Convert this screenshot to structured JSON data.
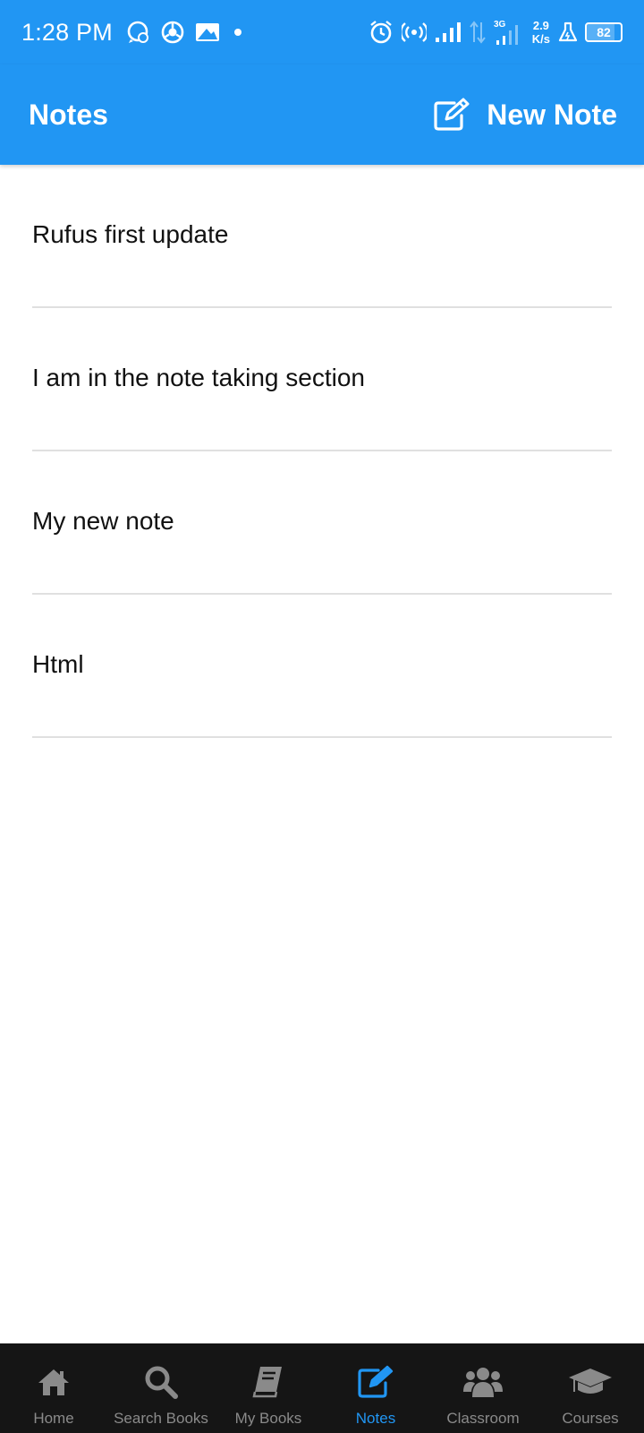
{
  "status_bar": {
    "time": "1:28 PM",
    "net_speed_value": "2.9",
    "net_speed_unit": "K/s",
    "network_type": "3G",
    "battery": "82",
    "battery_level": 0.82,
    "icons": [
      "whatsapp-icon",
      "chrome-icon",
      "gallery-icon",
      "dot-icon",
      "alarm-icon",
      "hotspot-icon",
      "signal-icon",
      "data-arrows-icon",
      "signal-3g-icon",
      "flask-icon",
      "battery-icon"
    ]
  },
  "app_bar": {
    "title": "Notes",
    "new_note_label": "New Note",
    "new_note_icon": "edit-icon"
  },
  "notes": [
    {
      "title": "Rufus first update"
    },
    {
      "title": "I am in the note taking section"
    },
    {
      "title": "My new note"
    },
    {
      "title": "Html"
    }
  ],
  "bottom_nav": {
    "active": "Notes",
    "items": [
      {
        "label": "Home",
        "icon": "home-icon"
      },
      {
        "label": "Search Books",
        "icon": "search-icon"
      },
      {
        "label": "My Books",
        "icon": "book-icon"
      },
      {
        "label": "Notes",
        "icon": "edit-icon"
      },
      {
        "label": "Classroom",
        "icon": "users-icon"
      },
      {
        "label": "Courses",
        "icon": "graduation-cap-icon"
      }
    ]
  },
  "colors": {
    "primary": "#2196F3",
    "nav_background": "#151515",
    "nav_inactive": "#8a8a8a",
    "divider": "#e0e0e0"
  }
}
